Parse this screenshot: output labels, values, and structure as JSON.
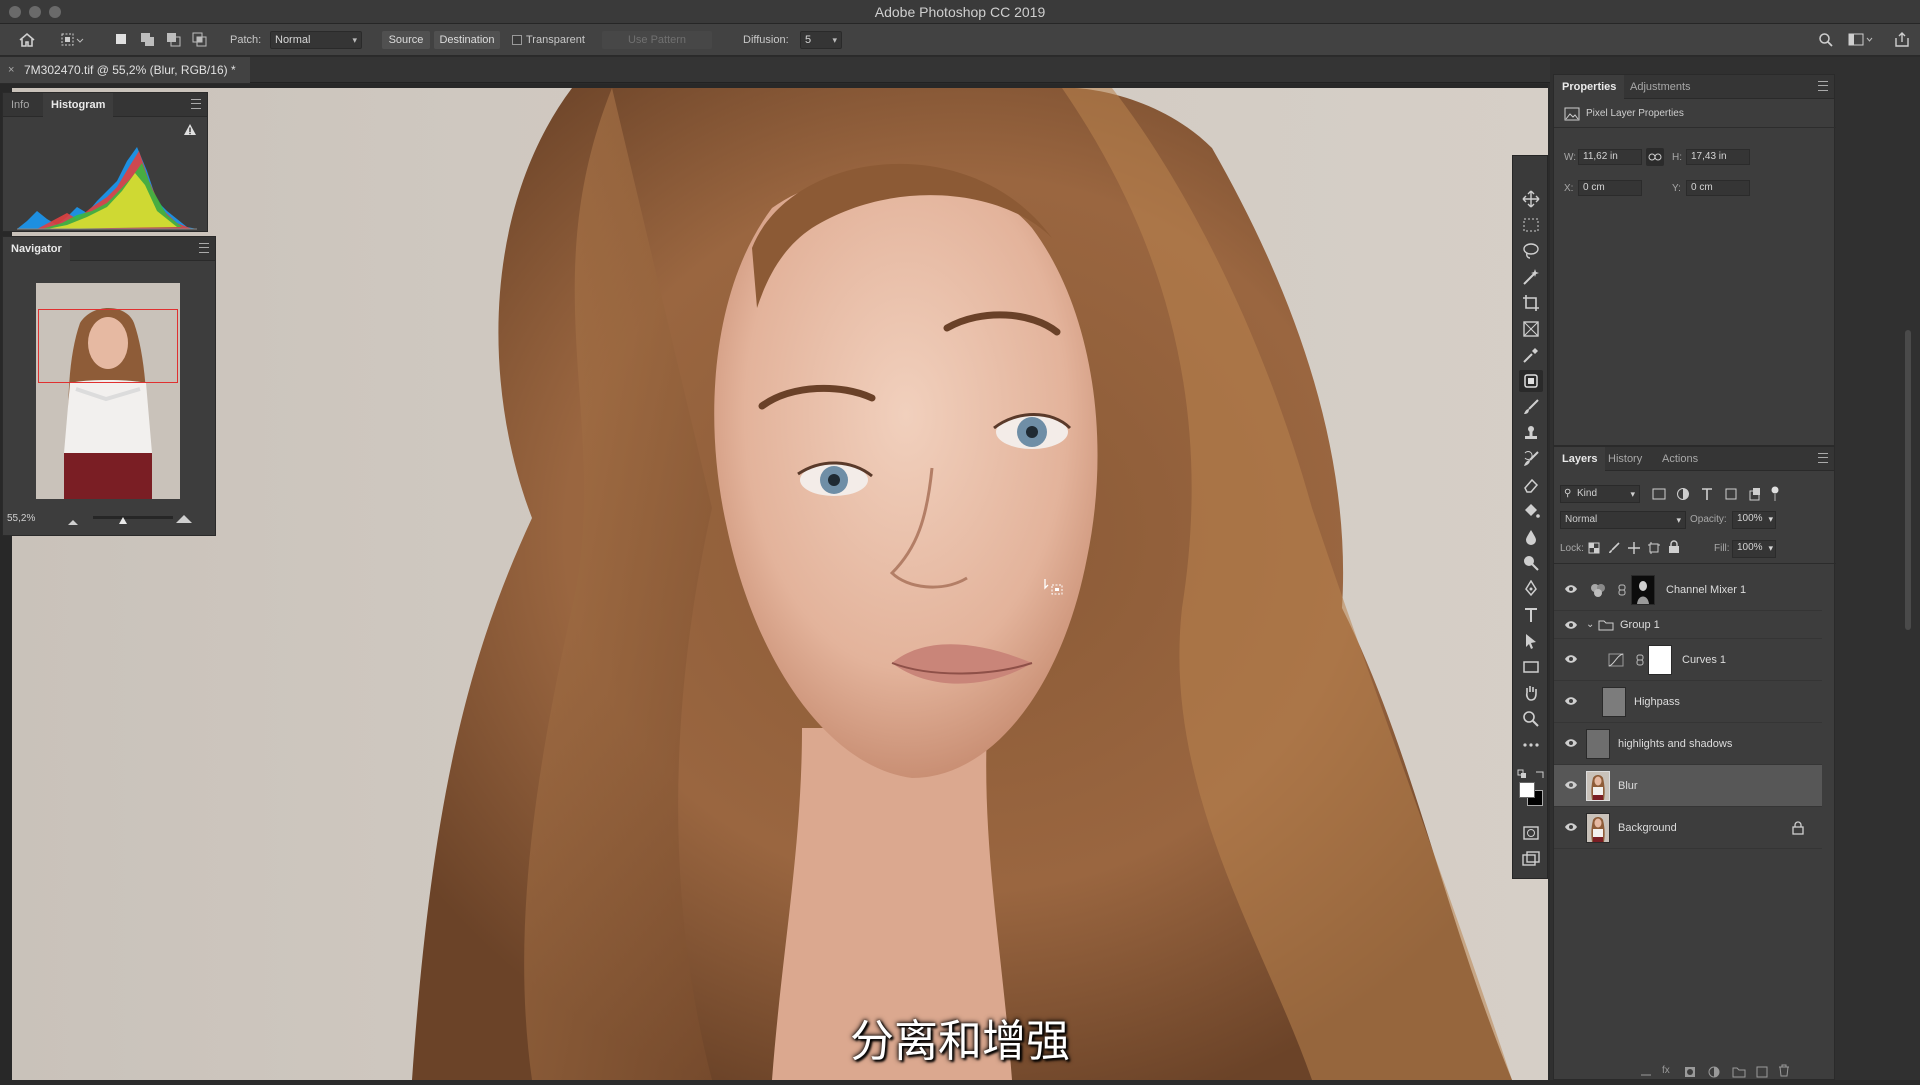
{
  "window": {
    "title": "Adobe Photoshop CC 2019"
  },
  "options_bar": {
    "patch_label": "Patch:",
    "patch_mode": "Normal",
    "source_label": "Source",
    "destination_label": "Destination",
    "transparent_label": "Transparent",
    "transparent_checked": false,
    "use_pattern_label": "Use Pattern",
    "diffusion_label": "Diffusion:",
    "diffusion_value": "5"
  },
  "document": {
    "tab_title": "7M302470.tif @ 55,2% (Blur, RGB/16) *",
    "close_glyph": "×"
  },
  "histogram_panel": {
    "tabs": [
      "Info",
      "Histogram"
    ],
    "active_tab": "Histogram",
    "warning_icon": "warning-icon"
  },
  "navigator_panel": {
    "title": "Navigator",
    "zoom": "55,2%",
    "zoom_fraction": 0.35
  },
  "properties_panel": {
    "tabs": [
      "Properties",
      "Adjustments"
    ],
    "active_tab": "Properties",
    "subtitle": "Pixel Layer Properties",
    "w_label": "W:",
    "w_value": "11,62 in",
    "h_label": "H:",
    "h_value": "17,43 in",
    "x_label": "X:",
    "x_value": "0 cm",
    "y_label": "Y:",
    "y_value": "0 cm"
  },
  "layers_panel": {
    "tabs": [
      "Layers",
      "History",
      "Actions"
    ],
    "active_tab": "Layers",
    "filter_kind": "Kind",
    "blend_mode": "Normal",
    "opacity_label": "Opacity:",
    "opacity_value": "100%",
    "lock_label": "Lock:",
    "fill_label": "Fill:",
    "fill_value": "100%",
    "layers": [
      {
        "name": "Channel Mixer 1",
        "type": "adjustment",
        "indent": 0
      },
      {
        "name": "Group 1",
        "type": "group",
        "indent": 0
      },
      {
        "name": "Curves 1",
        "type": "adjustment",
        "indent": 1
      },
      {
        "name": "Highpass",
        "type": "pixel",
        "indent": 1
      },
      {
        "name": "highlights and shadows",
        "type": "pixel",
        "indent": 0
      },
      {
        "name": "Blur",
        "type": "pixel",
        "indent": 0,
        "selected": true
      },
      {
        "name": "Background",
        "type": "pixel",
        "indent": 0,
        "locked": true
      }
    ]
  },
  "subtitle_text": "分离和增强",
  "colors": {
    "accent_selection": "#575757",
    "navigator_box": "#e03030"
  }
}
